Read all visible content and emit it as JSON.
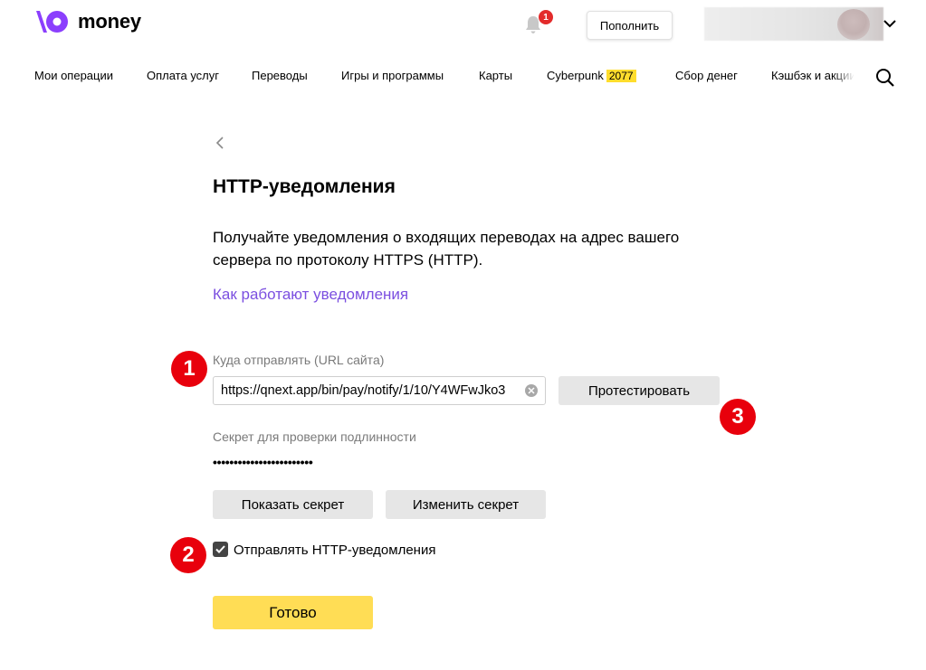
{
  "brand": {
    "name": "money",
    "logo_icon": "yoomoney-logo-icon",
    "accent_color": "#8b3ffd"
  },
  "header": {
    "notifications_count": "1",
    "topup_label": "Пополнить"
  },
  "nav": {
    "items": [
      "Мои операции",
      "Оплата услуг",
      "Переводы",
      "Игры и программы",
      "Карты",
      "Cyberpunk",
      "Сбор денег",
      "Кэшбэк и акции"
    ],
    "cyberpunk_badge": "2077"
  },
  "main": {
    "title": "HTTP-уведомления",
    "description": "Получайте уведомления о входящих переводах на адрес вашего сервера по протоколу HTTPS (HTTP).",
    "howto_link": "Как работают уведомления",
    "url_label": "Куда отправлять (URL сайта)",
    "url_value": "https://qnext.app/bin/pay/notify/1/10/Y4WFwJko3",
    "test_button": "Протестировать",
    "secret_label": "Секрет для проверки подлинности",
    "secret_value": "••••••••••••••••••••••••",
    "show_secret_button": "Показать секрет",
    "change_secret_button": "Изменить секрет",
    "send_checkbox_label": "Отправлять HTTP-уведомления",
    "send_checkbox_checked": true,
    "done_button": "Готово"
  },
  "markers": [
    "1",
    "2",
    "3"
  ],
  "colors": {
    "link": "#7b4fe0",
    "primary_button": "#ffdd55",
    "badge": "#ffdd2d",
    "marker": "#e8000c"
  }
}
